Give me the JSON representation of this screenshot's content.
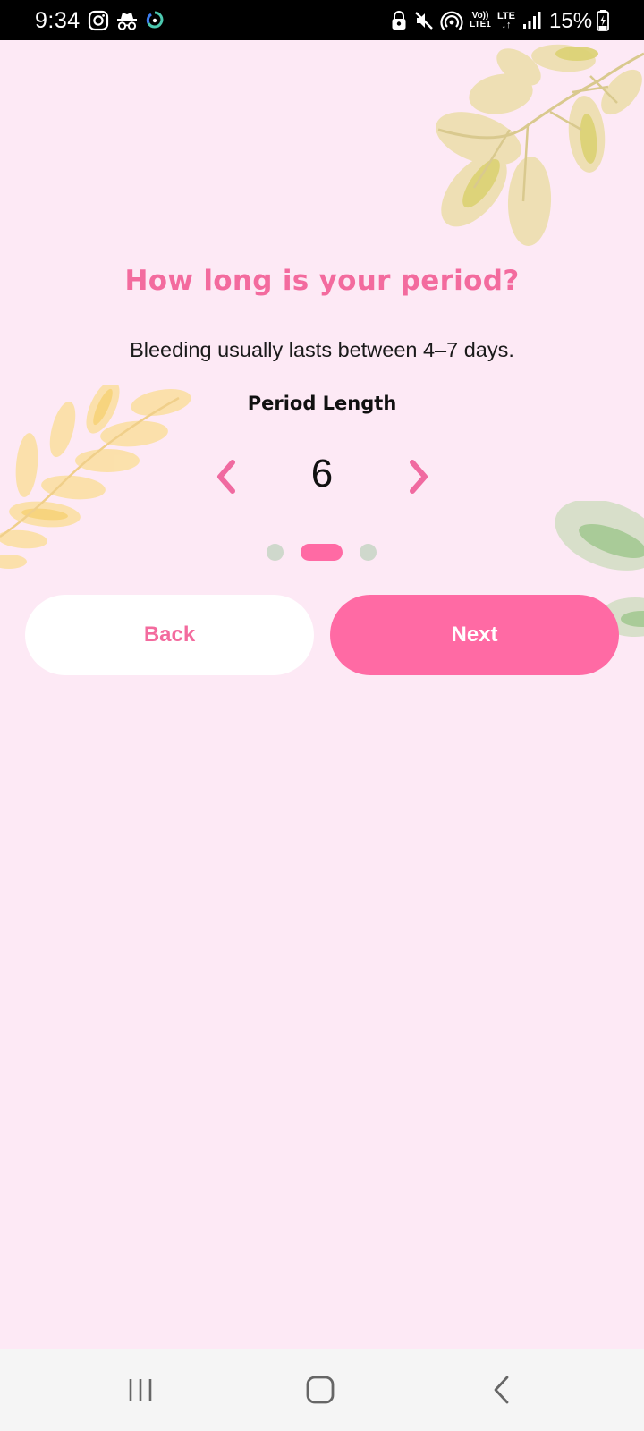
{
  "status_bar": {
    "time": "9:34",
    "battery": "15%",
    "volte_top": "Vo))",
    "volte_bottom": "LTE1",
    "lte_top": "LTE",
    "lte_bottom": "↓↑",
    "icons": [
      "instagram-icon",
      "incognito-icon",
      "sync-circle-icon",
      "vpn-lock-icon",
      "mute-icon",
      "hotspot-icon",
      "volte-icon",
      "lte-icon",
      "signal-icon",
      "battery-charging-icon"
    ]
  },
  "onboarding": {
    "title": "How long is your period?",
    "subtitle": "Bleeding usually lasts between 4–7 days.",
    "section_label": "Period Length",
    "stepper": {
      "value": "6",
      "decrement_icon": "chevron-left-icon",
      "increment_icon": "chevron-right-icon"
    },
    "progress": {
      "total_steps": 3,
      "current_step": 2
    },
    "back_label": "Back",
    "next_label": "Next"
  },
  "nav_bar": {
    "icons": [
      "recent-apps-icon",
      "home-icon",
      "back-icon"
    ]
  },
  "colors": {
    "background": "#fde9f5",
    "accent": "#ff6aa4",
    "title": "#f36b9e",
    "dot_inactive": "#cfd8cc"
  }
}
